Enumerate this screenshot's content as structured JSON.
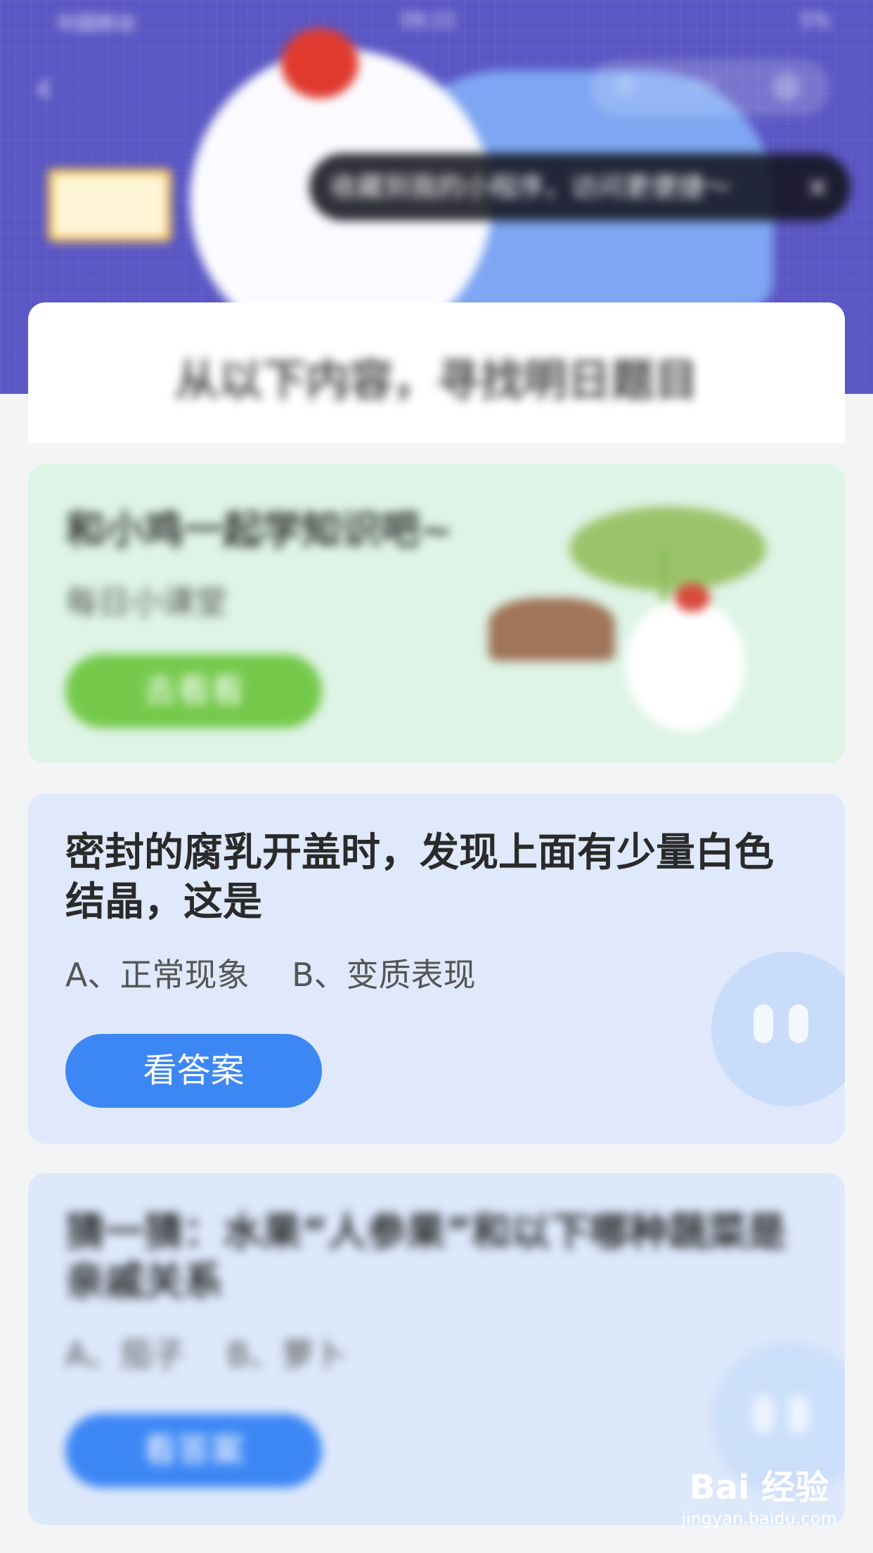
{
  "status_bar": {
    "carrier": "中国移动",
    "time": "09:21",
    "battery": "5%"
  },
  "nav": {
    "back_icon": "chevron-left-icon",
    "capsule_icons": [
      "star-icon",
      "more-icon",
      "target-icon"
    ]
  },
  "tooltip": {
    "text": "收藏到我的小程序，访问更便捷～",
    "close": "×"
  },
  "title_card": {
    "title": "从以下内容，寻找明日题目"
  },
  "cards": [
    {
      "title": "和小鸡一起学知识吧~",
      "subtitle": "每日小课堂",
      "button": "去看看"
    },
    {
      "title": "密封的腐乳开盖时，发现上面有少量白色结晶，这是",
      "options": "A、正常现象　 B、变质表现",
      "button": "看答案"
    },
    {
      "title": "猜一猜：水果“人参果”和以下哪种蔬菜是亲戚关系",
      "options": "A、茄子　 B、萝卜",
      "button": "看答案"
    }
  ],
  "watermark": {
    "brand": "Bai 经验",
    "url": "jingyan.baidu.com"
  },
  "colors": {
    "header": "#5b57c4",
    "green_button": "#74c94b",
    "blue_button": "#3d87f5",
    "card_green": "#def4e6",
    "card_blue": "#dfe9fb"
  }
}
